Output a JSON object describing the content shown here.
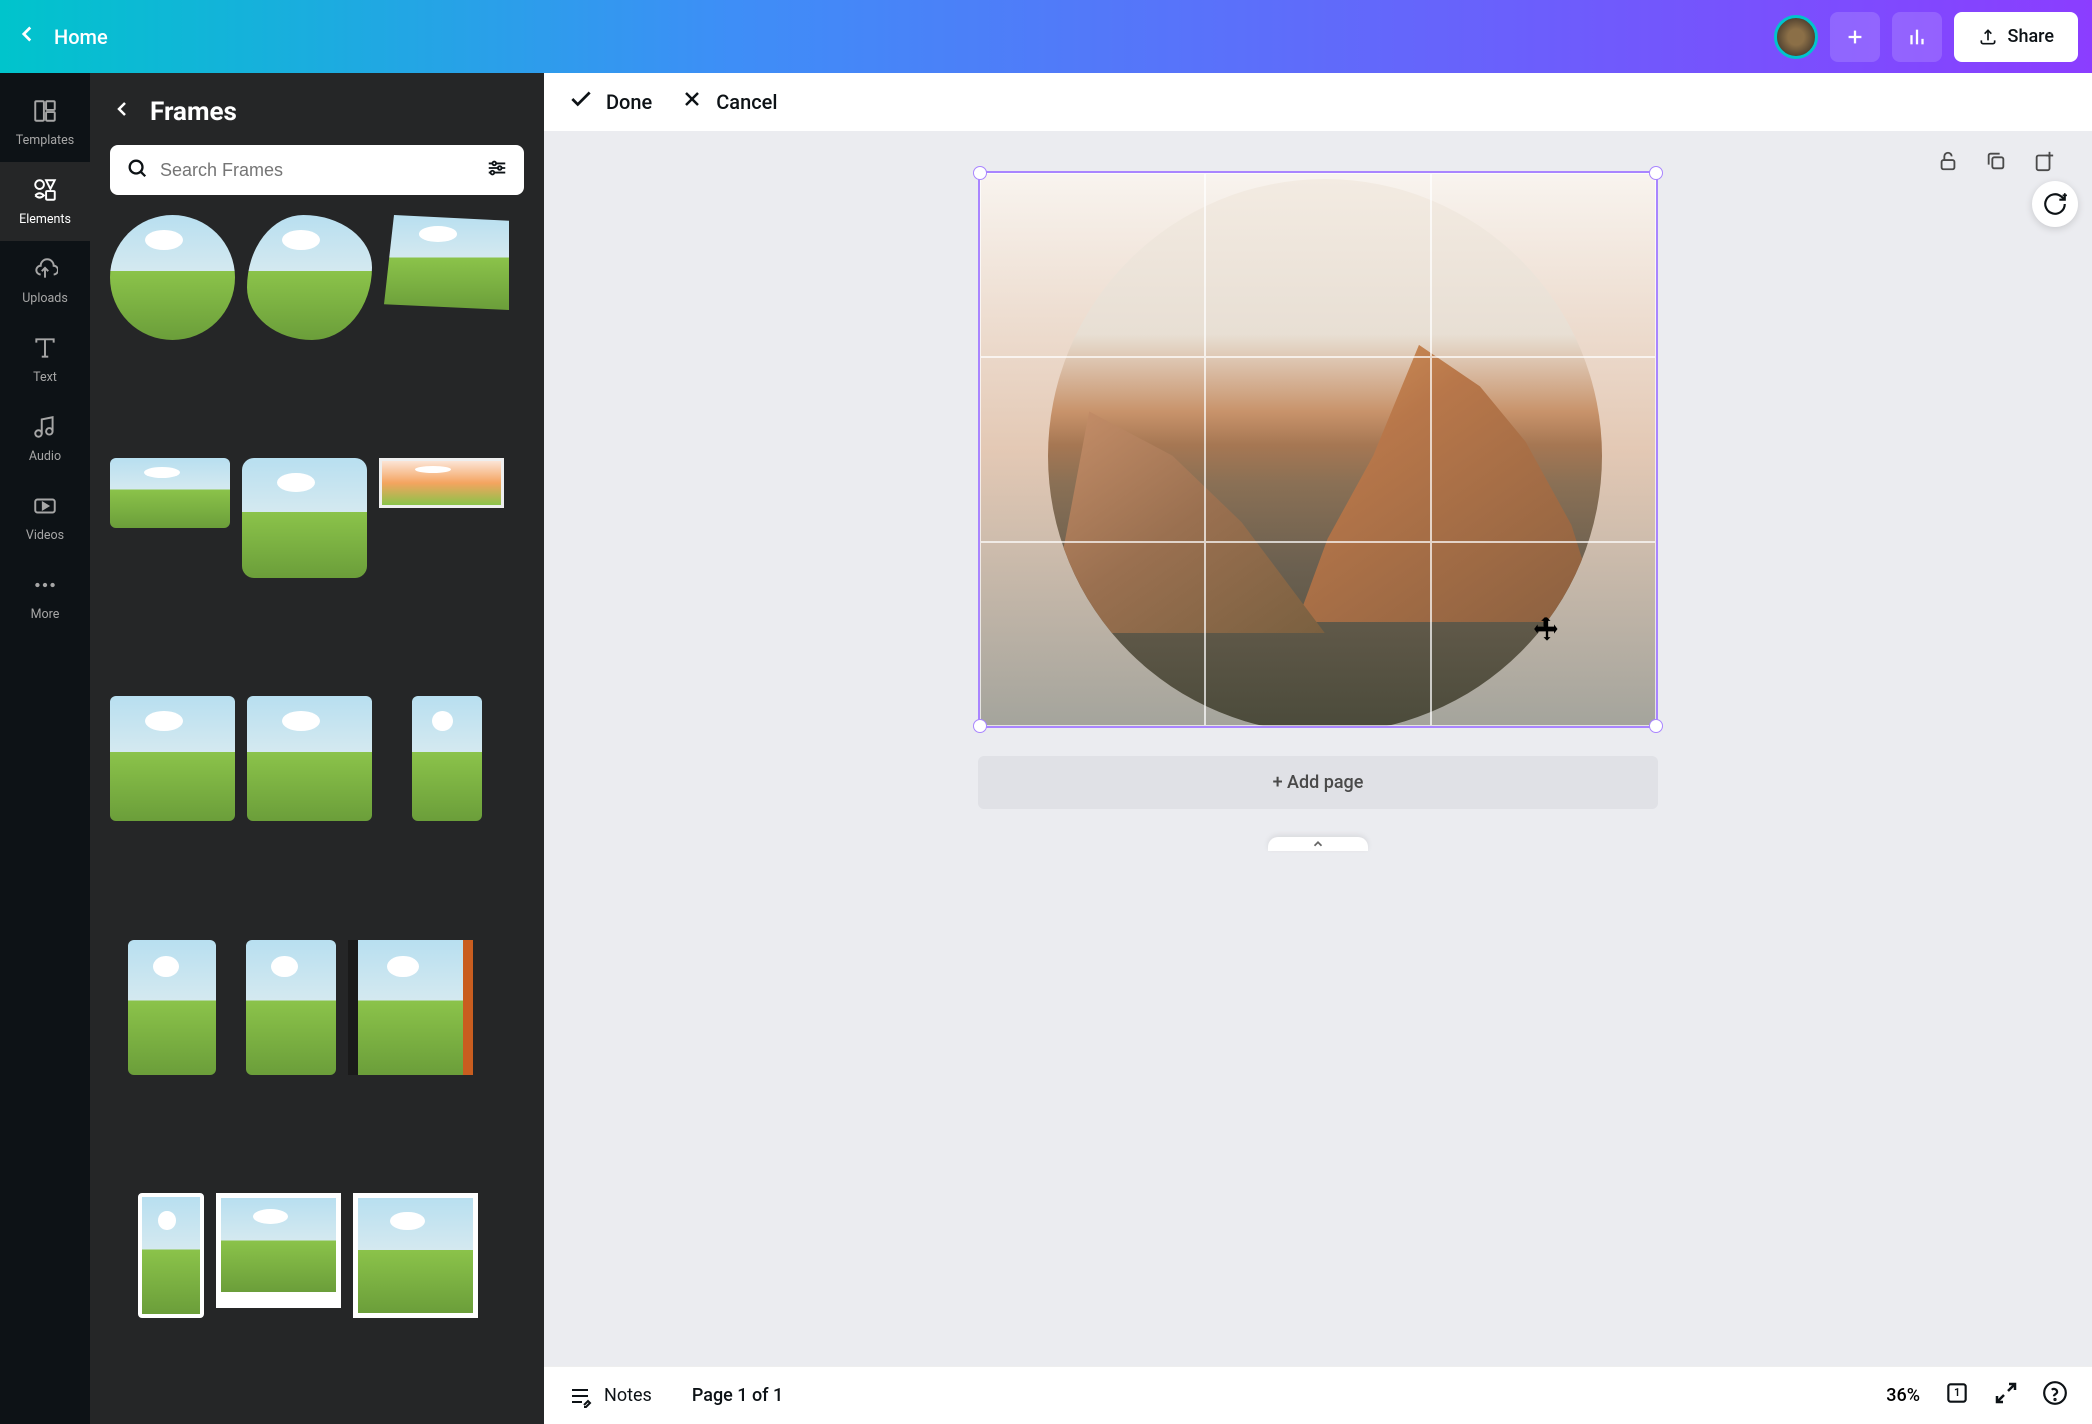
{
  "header": {
    "home_label": "Home",
    "share_label": "Share"
  },
  "leftnav": {
    "items": [
      {
        "label": "Templates",
        "icon": "templates-icon"
      },
      {
        "label": "Elements",
        "icon": "elements-icon"
      },
      {
        "label": "Uploads",
        "icon": "uploads-icon"
      },
      {
        "label": "Text",
        "icon": "text-icon"
      },
      {
        "label": "Audio",
        "icon": "audio-icon"
      },
      {
        "label": "Videos",
        "icon": "videos-icon"
      },
      {
        "label": "More",
        "icon": "more-icon"
      }
    ],
    "active_index": 1
  },
  "sidebar": {
    "title": "Frames",
    "search_placeholder": "Search Frames"
  },
  "canvas_toolbar": {
    "done_label": "Done",
    "cancel_label": "Cancel"
  },
  "canvas": {
    "add_page_label": "+ Add page"
  },
  "bottom": {
    "notes_label": "Notes",
    "page_indicator": "Page 1 of 1",
    "zoom": "36%",
    "page_count": "1"
  }
}
